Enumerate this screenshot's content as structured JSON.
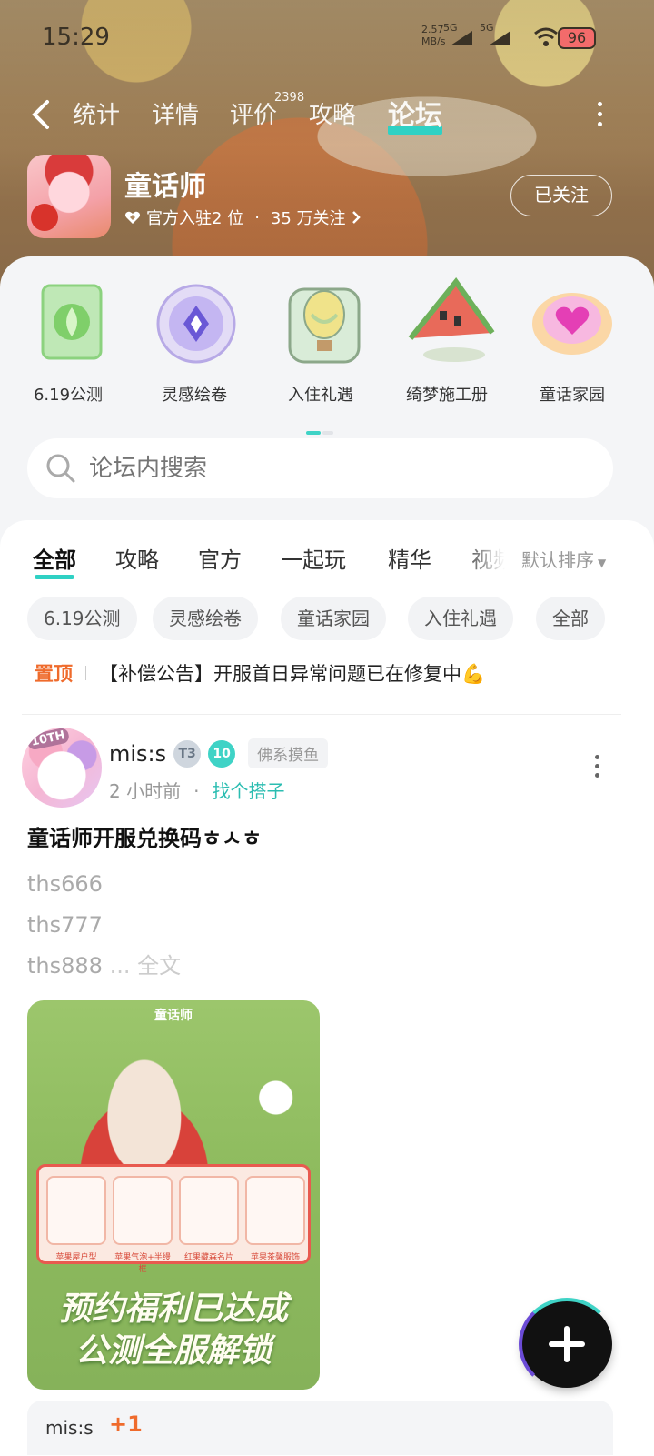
{
  "status_bar": {
    "time": "15:29",
    "speed_value": "2.57",
    "speed_unit": "MB/s",
    "network_1": "5G",
    "network_2": "5G",
    "battery": "96"
  },
  "nav": {
    "tabs": [
      {
        "label": "统计"
      },
      {
        "label": "详情"
      },
      {
        "label": "评价"
      },
      {
        "label": "攻略"
      },
      {
        "label": "论坛"
      }
    ],
    "active_tab": "论坛",
    "review_count": "2398"
  },
  "game": {
    "name": "童话师",
    "official_rank": "官方入驻2 位",
    "separator": "·",
    "followers": "35 万关注",
    "follow_label": "已关注"
  },
  "categories": [
    {
      "label": "6.19公测",
      "icon": "leaf-card-icon"
    },
    {
      "label": "灵感绘卷",
      "icon": "crystal-scroll-icon"
    },
    {
      "label": "入住礼遇",
      "icon": "hot-air-balloon-icon"
    },
    {
      "label": "绮梦施工册",
      "icon": "watermelon-house-icon"
    },
    {
      "label": "童话家园",
      "icon": "heart-shell-icon"
    }
  ],
  "search": {
    "placeholder": "论坛内搜索"
  },
  "feed_tabs": [
    {
      "label": "全部"
    },
    {
      "label": "攻略"
    },
    {
      "label": "官方"
    },
    {
      "label": "一起玩"
    },
    {
      "label": "精华"
    },
    {
      "label": "视频"
    }
  ],
  "sort_label": "默认排序",
  "chips": [
    {
      "label": "6.19公测"
    },
    {
      "label": "灵感绘卷"
    },
    {
      "label": "童话家园"
    },
    {
      "label": "入住礼遇"
    },
    {
      "label": "全部"
    }
  ],
  "pinned": {
    "tag": "置顶",
    "text": "【补偿公告】开服首日异常问题已在修复中💪"
  },
  "post": {
    "avatar_badge": "10TH",
    "username": "mis:s",
    "level_badge": "T3",
    "rank_badge": "10",
    "user_tag": "佛系摸鱼",
    "time": "2 小时前",
    "separator": "·",
    "topic": "找个搭子",
    "title": "童话师开服兑换码ㅎㅅㅎ",
    "body_lines": [
      "ths666",
      "ths777",
      "ths888"
    ],
    "more_label": "... 全文",
    "image": {
      "logo": "童话师",
      "card_labels": [
        "苹果屋户型",
        "苹果气泡+半缦框",
        "红果藏森名片",
        "苹果茶馨服饰"
      ],
      "headline_1": "预约福利已达成",
      "headline_2": "公测全服解锁"
    }
  },
  "next_post": {
    "username": "mis:s",
    "mark": "+1"
  },
  "colors": {
    "accent": "#2fd1c4",
    "pinned": "#ef6b2c",
    "topic": "#2bbdb1"
  }
}
